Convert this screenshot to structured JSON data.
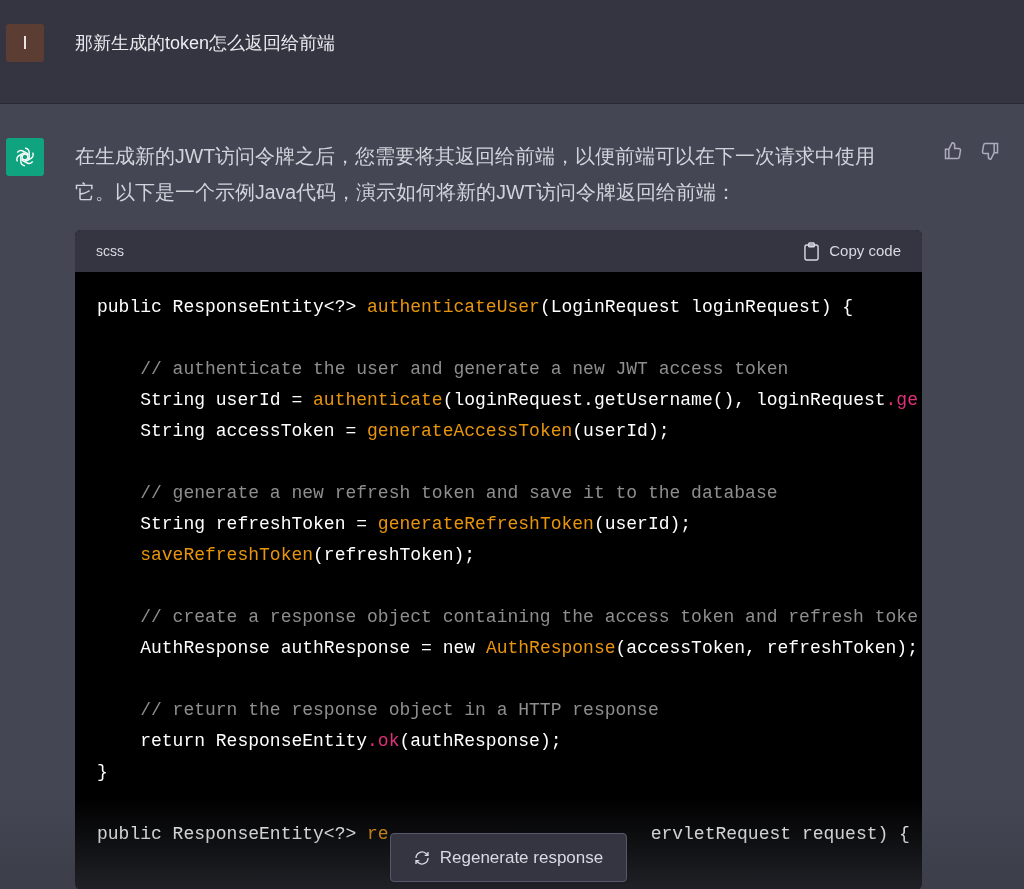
{
  "user_message": {
    "avatar": "I",
    "text": "那新生成的token怎么返回给前端"
  },
  "assistant_message": {
    "text": "在生成新的JWT访问令牌之后，您需要将其返回给前端，以便前端可以在下一次请求中使用它。以下是一个示例Java代码，演示如何将新的JWT访问令牌返回给前端：",
    "code_block": {
      "language": "scss",
      "copy_label": "Copy code",
      "paragraphs": [
        [
          [
            {
              "kind": "plain",
              "text": "public ResponseEntity<?> "
            },
            {
              "kind": "function",
              "text": "authenticateUser"
            },
            {
              "kind": "plain",
              "text": "(LoginRequest loginRequest) {"
            }
          ]
        ],
        [
          [
            {
              "kind": "comment",
              "text": "    // authenticate the user and generate a new JWT access token"
            }
          ],
          [
            {
              "kind": "plain",
              "text": "    String userId = "
            },
            {
              "kind": "function",
              "text": "authenticate"
            },
            {
              "kind": "plain",
              "text": "(loginRequest.getUsername(), loginRequest"
            },
            {
              "kind": "method",
              "text": ".ge"
            }
          ],
          [
            {
              "kind": "plain",
              "text": "    String accessToken = "
            },
            {
              "kind": "function",
              "text": "generateAccessToken"
            },
            {
              "kind": "plain",
              "text": "(userId);"
            }
          ]
        ],
        [
          [
            {
              "kind": "comment",
              "text": "    // generate a new refresh token and save it to the database"
            }
          ],
          [
            {
              "kind": "plain",
              "text": "    String refreshToken = "
            },
            {
              "kind": "function",
              "text": "generateRefreshToken"
            },
            {
              "kind": "plain",
              "text": "(userId);"
            }
          ],
          [
            {
              "kind": "function",
              "text": "    saveRefreshToken"
            },
            {
              "kind": "plain",
              "text": "(refreshToken);"
            }
          ]
        ],
        [
          [
            {
              "kind": "comment",
              "text": "    // create a response object containing the access token and refresh toke"
            }
          ],
          [
            {
              "kind": "plain",
              "text": "    AuthResponse authResponse = new "
            },
            {
              "kind": "function",
              "text": "AuthResponse"
            },
            {
              "kind": "plain",
              "text": "(accessToken, refreshToken);"
            }
          ]
        ],
        [
          [
            {
              "kind": "comment",
              "text": "    // return the response object in a HTTP response"
            }
          ],
          [
            {
              "kind": "plain",
              "text": "    return ResponseEntity"
            },
            {
              "kind": "method",
              "text": ".ok"
            },
            {
              "kind": "plain",
              "text": "(authResponse);"
            }
          ],
          [
            {
              "kind": "plain",
              "text": "}"
            }
          ]
        ],
        [
          [
            {
              "kind": "plain",
              "text": "public ResponseEntity<?> "
            },
            {
              "kind": "function",
              "text": "re"
            },
            {
              "kind": "gap"
            },
            {
              "kind": "plain",
              "text": "ervletRequest request) {"
            }
          ]
        ]
      ]
    }
  },
  "regenerate_button": {
    "label": "Regenerate response"
  }
}
